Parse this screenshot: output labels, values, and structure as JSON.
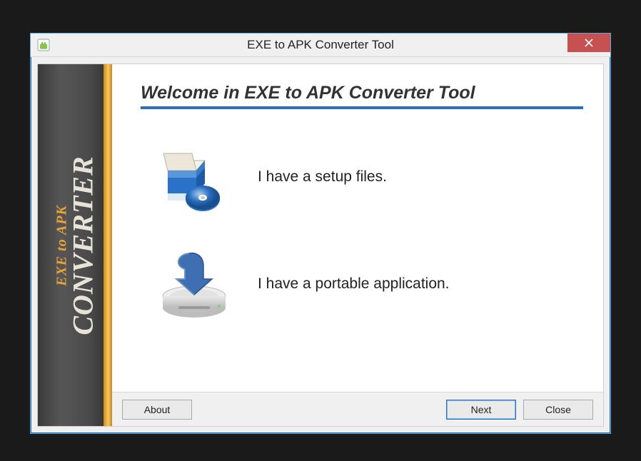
{
  "window": {
    "title": "EXE to APK Converter Tool",
    "close_icon": "close-icon"
  },
  "sidebar": {
    "line1": "EXE to APK",
    "line2": "CONVERTER"
  },
  "main": {
    "heading": "Welcome in EXE to APK Converter Tool",
    "options": [
      {
        "id": "setup",
        "label": "I have a setup files."
      },
      {
        "id": "portable",
        "label": "I have a portable application."
      }
    ]
  },
  "buttons": {
    "about": "About",
    "next": "Next",
    "close": "Close"
  },
  "colors": {
    "accent": "#2a6fbf",
    "gold": "#e8a437",
    "danger": "#c75050"
  }
}
